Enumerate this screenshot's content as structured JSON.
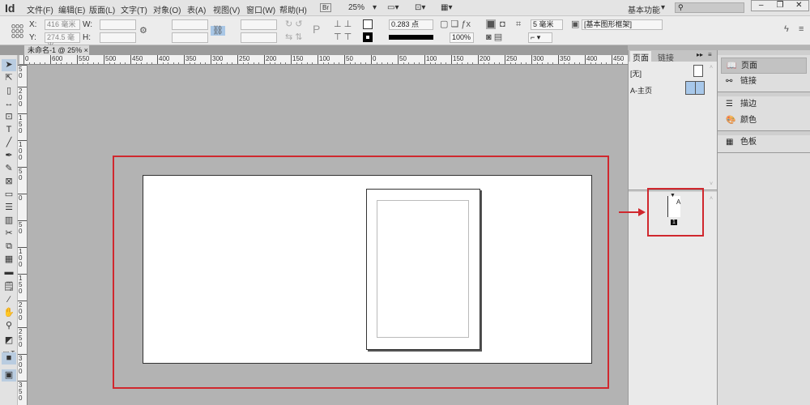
{
  "app": {
    "logo": "Id",
    "workspace": "基本功能",
    "search_placeholder": ""
  },
  "menu": [
    "文件(F)",
    "编辑(E)",
    "版面(L)",
    "文字(T)",
    "对象(O)",
    "表(A)",
    "视图(V)",
    "窗口(W)",
    "帮助(H)"
  ],
  "menubar": {
    "bridge": "Br",
    "zoom": "25%"
  },
  "control": {
    "x_label": "X:",
    "x_value": "416 毫米",
    "y_label": "Y:",
    "y_value": "274.5 毫米",
    "w_label": "W:",
    "h_label": "H:",
    "stroke_weight": "0.283 点",
    "opacity": "100%",
    "corner_size": "5 毫米",
    "object_style": "[基本图形框架]"
  },
  "document_tab": {
    "title": "未命名-1 @ 25%",
    "close": "×"
  },
  "ruler": {
    "h": [
      "0",
      "600",
      "550",
      "500",
      "450",
      "400",
      "350",
      "300",
      "250",
      "200",
      "150",
      "100",
      "50",
      "0",
      "50",
      "100",
      "150",
      "200",
      "250",
      "300",
      "350",
      "400",
      "450"
    ],
    "v": [
      "50",
      "200",
      "150",
      "100",
      "50",
      "0",
      "50",
      "100",
      "150",
      "200",
      "250",
      "300",
      "350"
    ]
  },
  "pages_panel": {
    "tabs": [
      "页面",
      "链接"
    ],
    "masters": [
      "[无]",
      "A-主页"
    ],
    "page_master_letter": "A",
    "page_number": "1"
  },
  "dock": [
    "页面",
    "链接",
    "描边",
    "颜色",
    "色板"
  ],
  "colors": {
    "highlight": "#d0282e"
  }
}
